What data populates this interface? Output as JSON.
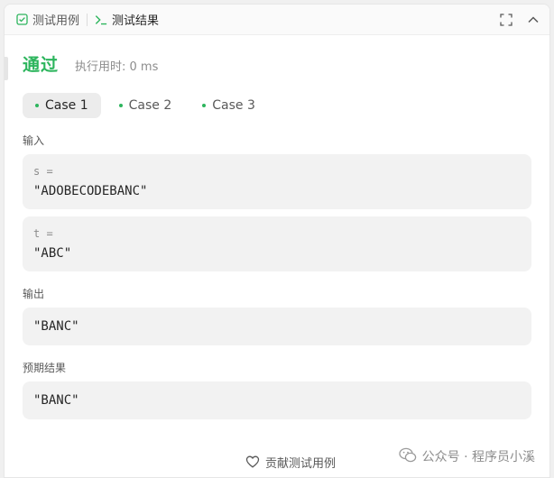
{
  "tabs": [
    {
      "label": "测试用例",
      "icon": "checkbox-icon"
    },
    {
      "label": "测试结果",
      "icon": "terminal-icon"
    }
  ],
  "actions": {
    "expand_icon": "expand-icon",
    "collapse_icon": "chevron-up-icon"
  },
  "result": {
    "status": "通过",
    "runtime_label": "执行用时: 0 ms"
  },
  "cases": [
    {
      "label": "Case 1"
    },
    {
      "label": "Case 2"
    },
    {
      "label": "Case 3"
    }
  ],
  "input": {
    "label": "输入",
    "params": [
      {
        "name": "s =",
        "value": "\"ADOBECODEBANC\""
      },
      {
        "name": "t =",
        "value": "\"ABC\""
      }
    ]
  },
  "output": {
    "label": "输出",
    "value": "\"BANC\""
  },
  "expected": {
    "label": "预期结果",
    "value": "\"BANC\""
  },
  "footer": {
    "contribute_label": "贡献测试用例"
  },
  "watermark": {
    "text": "公众号 · 程序员小溪"
  },
  "colors": {
    "accent": "#2db55d",
    "box_bg": "#f2f2f2"
  }
}
